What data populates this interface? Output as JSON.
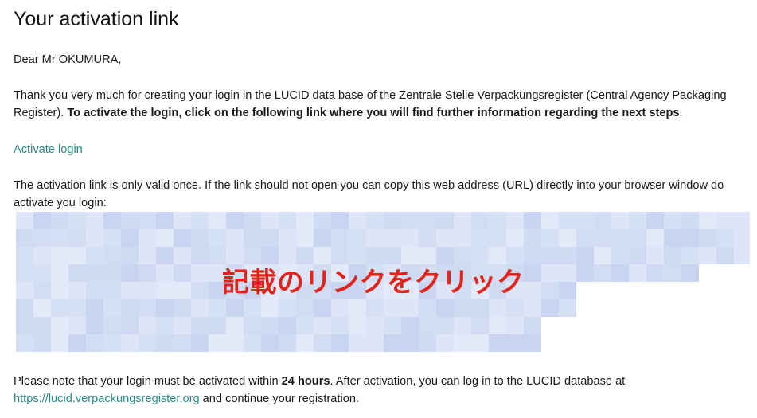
{
  "email": {
    "title": "Your activation link",
    "greeting": "Dear Mr OKUMURA,",
    "intro_text": "Thank you very much for creating your login in the LUCID data base of the Zentrale Stelle Verpackungsregister (Central Agency Packaging Register). ",
    "intro_bold": "To activate the login, click on the following link where you will find further information regarding the next steps",
    "intro_end": ".",
    "activate_link_label": "Activate login",
    "validity_text": "The activation link is only valid once. If the link should not open you can copy this web address (URL) directly into your browser window do activate you login:",
    "note_text_1": "Please note that your login must be activated within ",
    "note_bold": "24 hours",
    "note_text_2": ". After activation, you can log in to the LUCID database at ",
    "note_link": "https://lucid.verpackungsregister.org",
    "note_text_3": " and continue your registration."
  },
  "overlay": {
    "annotation_text": "記載のリンクをクリック",
    "annotation_color": "#e2231a"
  },
  "colors": {
    "link": "#2a8a8a",
    "blur_tint": "#d6e0f4",
    "text": "#1a1a1a"
  }
}
